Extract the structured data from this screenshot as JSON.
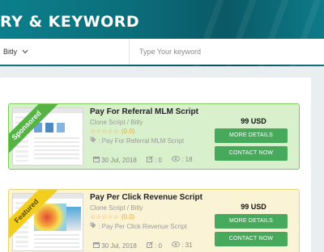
{
  "hero": {
    "title": "RY & KEYWORD"
  },
  "search": {
    "category_value": "Bitly",
    "keyword_placeholder": "Type Your keyword"
  },
  "listings": [
    {
      "ribbon": "Sponsored",
      "title": "Pay For Referral MLM Script",
      "category": "Clone Script / Bitly",
      "stars": "☆☆☆☆☆",
      "rating": "(0.0)",
      "tags": ": Pay For Referral MLM Script",
      "date": "30 Jul, 2018",
      "edits": ": 0",
      "views": ": 18",
      "price": "99 USD",
      "more_label": "MORE DETAILS",
      "contact_label": "CONTACT NOW"
    },
    {
      "ribbon": "Featured",
      "title": "Pay Per Click Revenue Script",
      "category": "Clone Script / Bitly",
      "stars": "☆☆☆☆☆",
      "rating": "(0.0)",
      "tags": ": Pay Per Click Revenue Script",
      "date": "30 Jul, 2018",
      "edits": ": 0",
      "views": ": 31",
      "price": "99 USD",
      "more_label": "MORE DETAILS",
      "contact_label": "CONTACT NOW"
    }
  ],
  "colors": {
    "hero_bg": "#0b6e7a",
    "button_green": "#47a95b",
    "sponsored_bg": "#d9f0cd",
    "featured_bg": "#fbf3d6",
    "star_orange": "#f0a926"
  },
  "icons": [
    "chevron-down-icon",
    "tag-icon",
    "calendar-icon",
    "edit-icon",
    "eye-icon"
  ]
}
